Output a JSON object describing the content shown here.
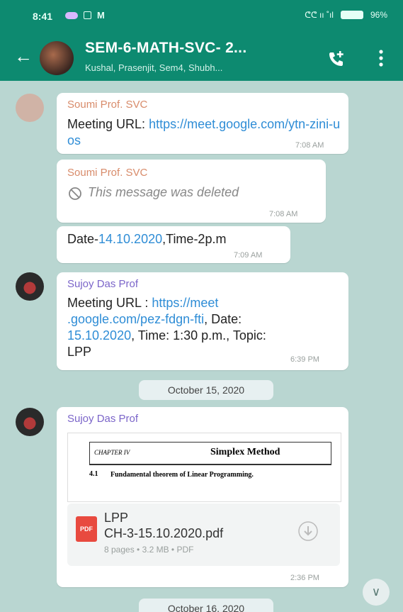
{
  "status": {
    "time": "8:41",
    "right_text": "ᕦᕦ ıı ˚ıl",
    "battery": "96%"
  },
  "header": {
    "back_icon": "←",
    "title": "SEM-6-MATH-SVC- 2...",
    "subtitle": "Kushal, Prasenjit, Sem4, Shubh..."
  },
  "messages": [
    {
      "sender": "Soumi Prof. SVC",
      "text_prefix": "Meeting URL: ",
      "link": "https://meet.google.com/ytn-zini-uos",
      "time": "7:08 AM"
    },
    {
      "sender": "Soumi Prof. SVC",
      "deleted_text": "This message was deleted",
      "time": "7:08 AM"
    },
    {
      "text_prefix": "Date-",
      "link": "14.10.2020",
      "text_suffix": ",Time-2p.m",
      "time": "7:09 AM"
    },
    {
      "sender": "Sujoy Das Prof",
      "line1_prefix": "Meeting URL : ",
      "line1_link": "https://meet",
      "line2_link": ".google.com/pez-fdgn-fti",
      "line2_suffix": ", Date:",
      "line3_link": "15.10.2020",
      "line3_suffix": ", Time: 1:30 p.m., Topic:",
      "line4": "LPP",
      "time": "6:39 PM"
    },
    {
      "sender": "Sujoy Das Prof",
      "pdf": {
        "preview_chapter": "CHAPTER IV",
        "preview_title": "Simplex Method",
        "preview_section_num": "4.1",
        "preview_section": "Fundamental theorem of Linear Programming.",
        "name_line1": "LPP",
        "name_line2": "CH-3-15.10.2020.pdf",
        "meta": "8 pages • 3.2 MB • PDF",
        "badge": "PDF"
      },
      "time": "2:36 PM"
    }
  ],
  "dates": {
    "chip1": "October 15, 2020",
    "chip2": "October 16, 2020"
  },
  "colors": {
    "appbar": "#0d8a70",
    "chat_bg": "#b9d6d1",
    "sender_soumi": "#d88b6a",
    "sender_sujoy": "#7b65c9",
    "link": "#2f8dd6"
  }
}
